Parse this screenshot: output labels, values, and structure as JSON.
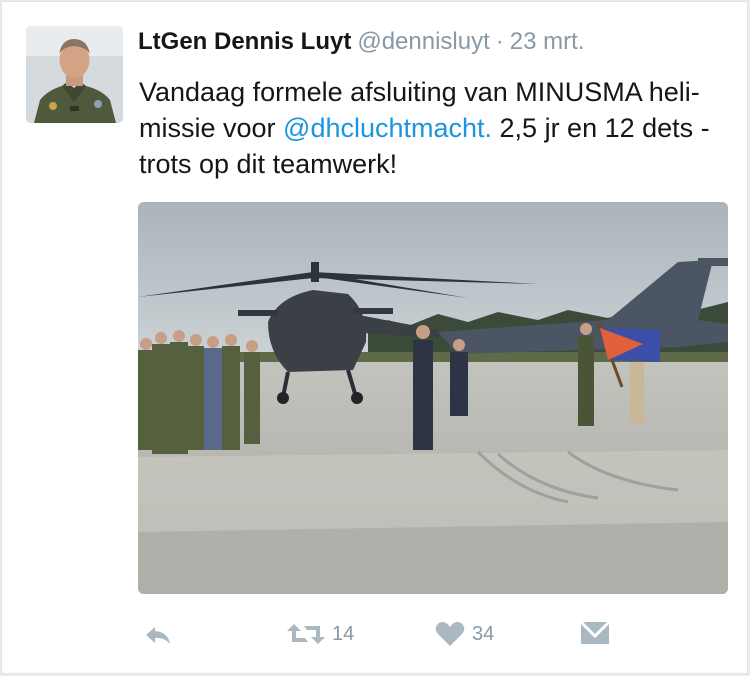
{
  "tweet": {
    "author_name": "LtGen Dennis Luyt",
    "handle": "@dennisluyt",
    "separator": "·",
    "date": "23 mrt.",
    "text_part1": "Vandaag formele afsluiting van MINUSMA heli- missie voor ",
    "mention": "@dhcluchtmacht.",
    "text_part2": " 2,5 jr en 12 dets - trots op dit teamwerk!"
  },
  "actions": {
    "reply_icon": "reply-icon",
    "retweet_icon": "retweet-icon",
    "retweet_count": "14",
    "like_icon": "heart-icon",
    "like_count": "34",
    "dm_icon": "direct-message-icon"
  },
  "colors": {
    "text": "#14171a",
    "muted": "#8899a6",
    "link": "#1b95e0",
    "icon": "#aab8c2"
  }
}
